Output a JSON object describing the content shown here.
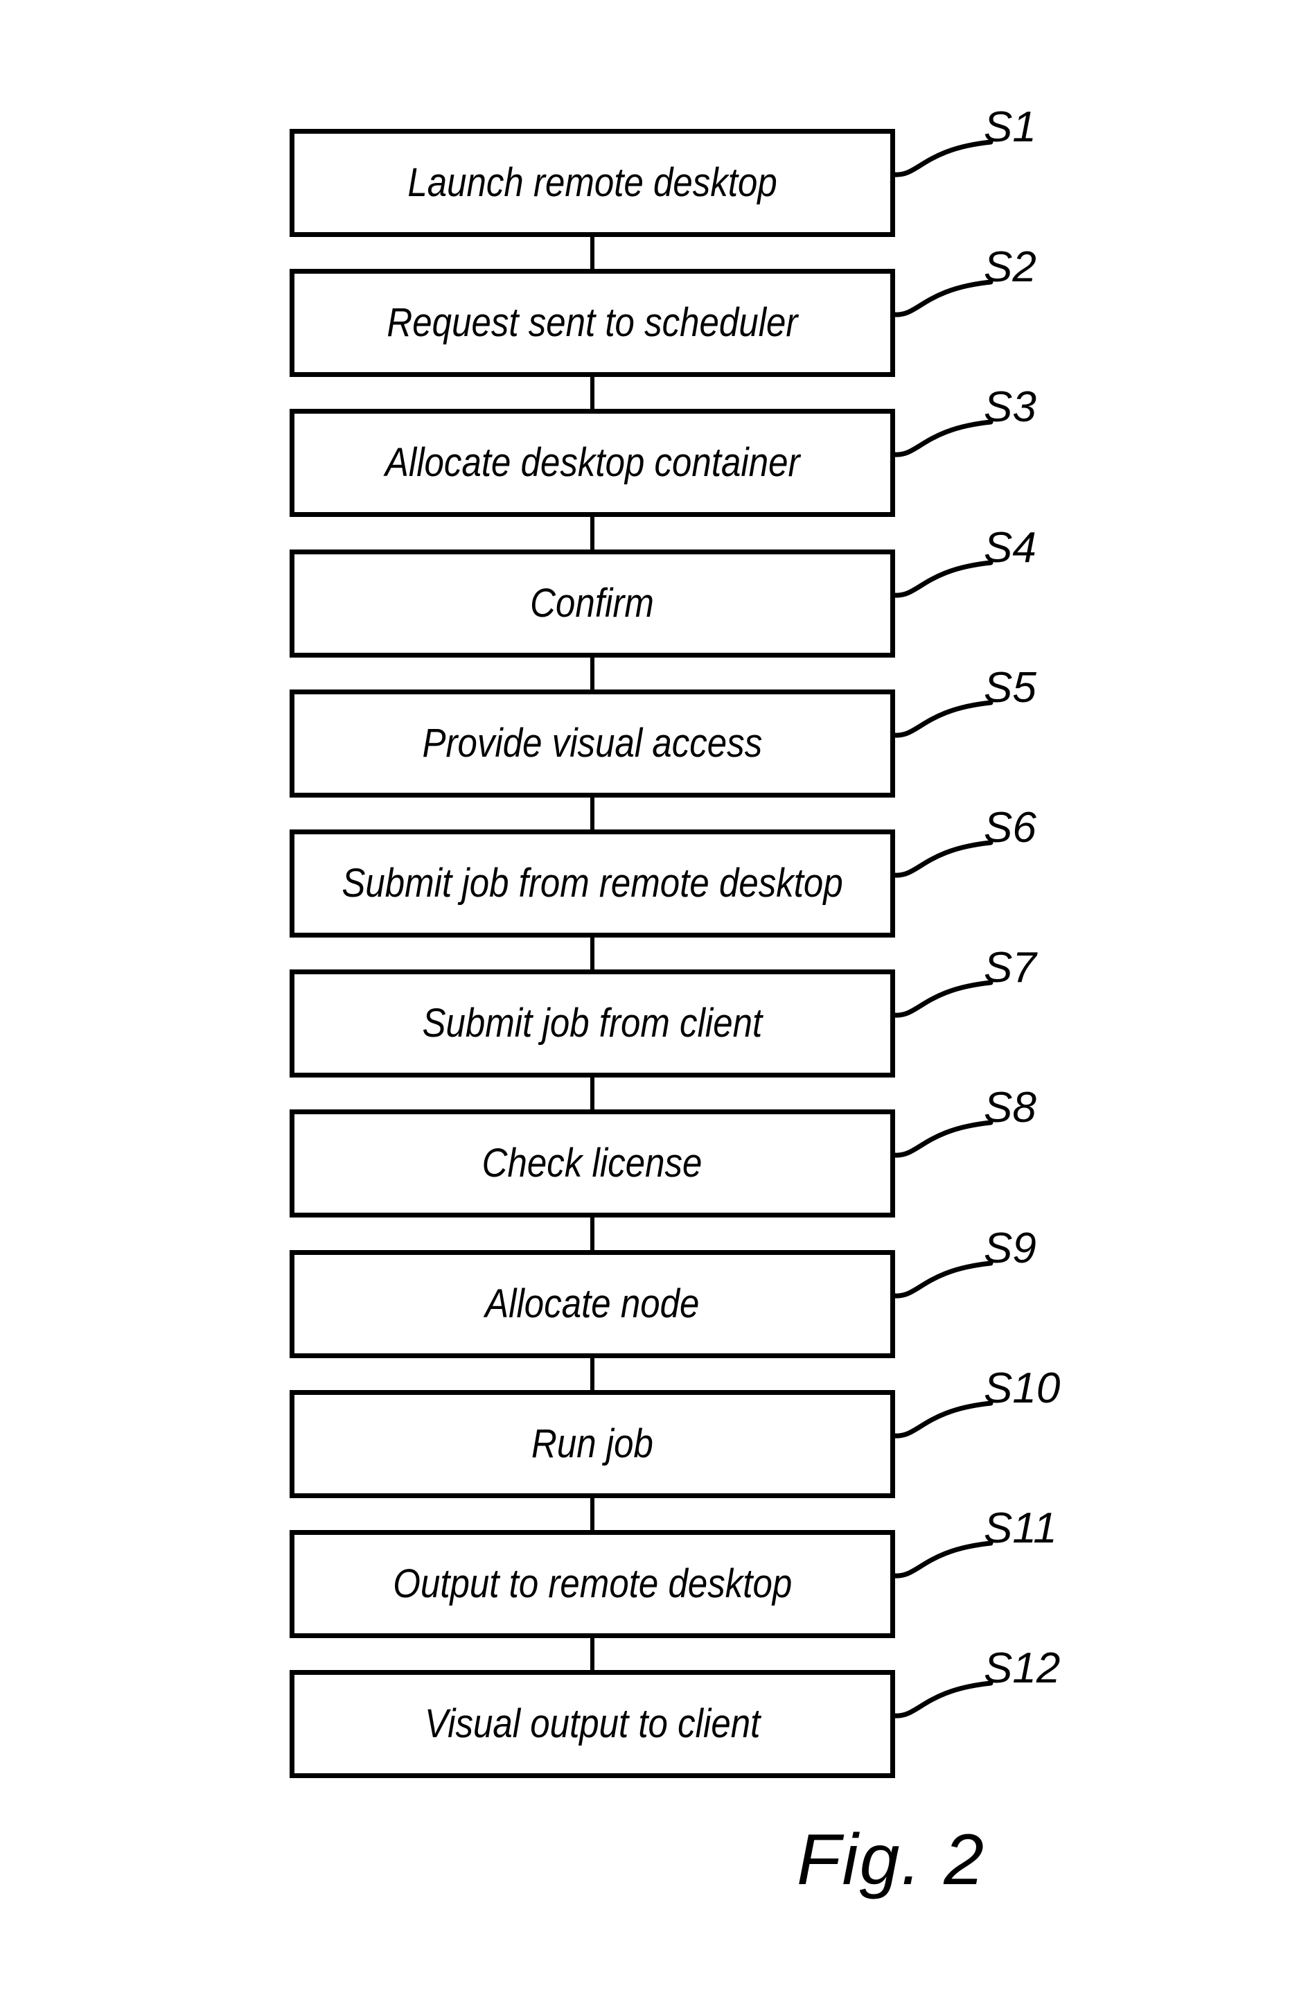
{
  "figure": {
    "caption": "Fig. 2",
    "type": "flowchart",
    "orientation": "vertical",
    "background_color": "#ffffff",
    "line_color": "#000000"
  },
  "flow": {
    "steps": [
      {
        "id": "S1",
        "label": "Launch remote desktop",
        "step_ref": "S1"
      },
      {
        "id": "S2",
        "label": "Request sent to scheduler",
        "step_ref": "S2"
      },
      {
        "id": "S3",
        "label": "Allocate desktop container",
        "step_ref": "S3"
      },
      {
        "id": "S4",
        "label": "Confirm",
        "step_ref": "S4"
      },
      {
        "id": "S5",
        "label": "Provide visual access",
        "step_ref": "S5"
      },
      {
        "id": "S6",
        "label": "Submit job from remote desktop",
        "step_ref": "S6"
      },
      {
        "id": "S7",
        "label": "Submit job from client",
        "step_ref": "S7"
      },
      {
        "id": "S8",
        "label": "Check license",
        "step_ref": "S8"
      },
      {
        "id": "S9",
        "label": "Allocate node",
        "step_ref": "S9"
      },
      {
        "id": "S10",
        "label": "Run job",
        "step_ref": "S10"
      },
      {
        "id": "S11",
        "label": "Output to remote desktop",
        "step_ref": "S11"
      },
      {
        "id": "S12",
        "label": "Visual output to client",
        "step_ref": "S12"
      }
    ]
  }
}
